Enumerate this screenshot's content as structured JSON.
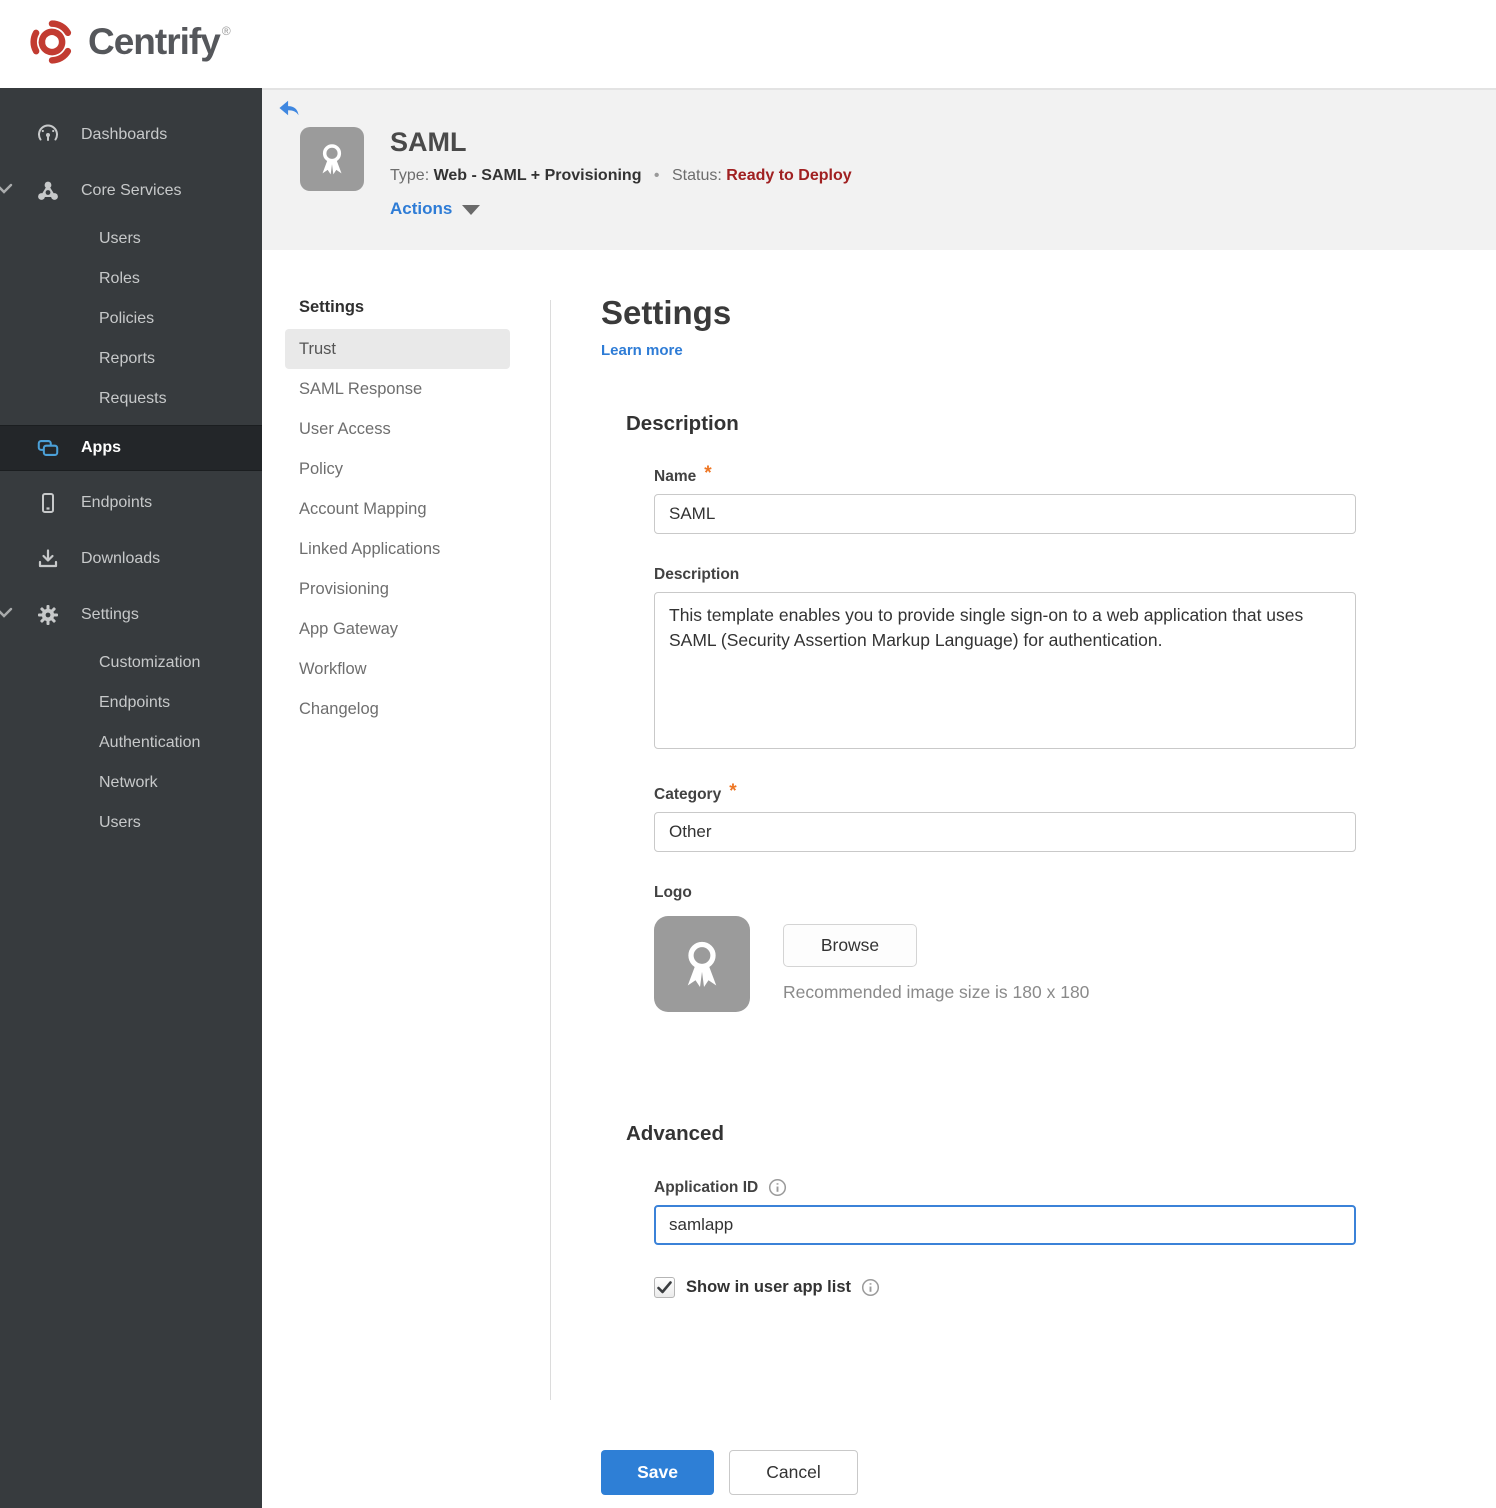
{
  "brand": {
    "name": "Centrify",
    "trademark": "®"
  },
  "sidebar": {
    "items": [
      {
        "label": "Dashboards"
      },
      {
        "label": "Core Services",
        "expanded": true,
        "children": [
          "Users",
          "Roles",
          "Policies",
          "Reports",
          "Requests"
        ]
      },
      {
        "label": "Apps",
        "active": true
      },
      {
        "label": "Endpoints"
      },
      {
        "label": "Downloads"
      },
      {
        "label": "Settings",
        "expanded": true,
        "children": [
          "Customization",
          "Endpoints",
          "Authentication",
          "Network",
          "Users"
        ]
      }
    ]
  },
  "header": {
    "title": "SAML",
    "type_label": "Type:",
    "type_value": "Web - SAML + Provisioning",
    "separator": "•",
    "status_label": "Status:",
    "status_value": "Ready to Deploy",
    "actions_label": "Actions"
  },
  "subnav": {
    "heading": "Settings",
    "active": "Trust",
    "items": [
      "Trust",
      "SAML Response",
      "User Access",
      "Policy",
      "Account Mapping",
      "Linked Applications",
      "Provisioning",
      "App Gateway",
      "Workflow",
      "Changelog"
    ]
  },
  "main": {
    "title": "Settings",
    "learn_more": "Learn more",
    "required_marker": "*",
    "description_section": {
      "heading": "Description",
      "name_label": "Name",
      "name_value": "SAML",
      "description_label": "Description",
      "description_value": "This template enables you to provide single sign-on to a web application that uses SAML (Security Assertion Markup Language) for authentication.",
      "category_label": "Category",
      "category_value": "Other",
      "logo_label": "Logo",
      "browse_label": "Browse",
      "logo_hint": "Recommended image size is 180 x 180"
    },
    "advanced_section": {
      "heading": "Advanced",
      "application_id_label": "Application ID",
      "application_id_value": "samlapp",
      "show_in_app_list_label": "Show in user app list",
      "checkbox_checked": true
    },
    "save_label": "Save",
    "cancel_label": "Cancel"
  },
  "icons": {
    "brand_logo": "red tri-arc swirl",
    "dashboards": "gauge",
    "core_services": "node-cluster",
    "apps": "stacked-windows",
    "endpoints": "smartphone",
    "downloads": "download-tray",
    "settings": "gear",
    "back": "arrow-left",
    "app_logo": "award-ribbon",
    "info": "circled-i",
    "caret": "triangle-down",
    "checkmark": "check"
  },
  "colors": {
    "accent_blue": "#2e7fd6",
    "link_blue": "#2e7cd6",
    "status_red": "#a02021",
    "asterisk_orange": "#ee7623",
    "sidebar_bg": "#373b3e",
    "sidebar_active_bg": "#232629",
    "apps_icon_blue": "#4ba0d8",
    "header_band": "#f2f2f2",
    "brand_red": "#c23b31",
    "focus_border": "#3b82d8"
  }
}
